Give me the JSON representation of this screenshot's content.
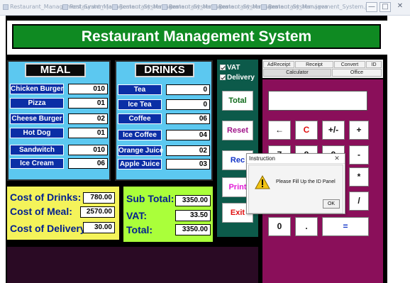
{
  "window": {
    "tabs": [
      "Restaurant_Management_System.java",
      "Restaurant_Management_System.java",
      "Restaurant_Management_System.java",
      "Restaurant_Management_System.java",
      "Restaurant_Management_System.java",
      "Restaurant_Management_System.java"
    ],
    "minimize": "—",
    "maximize": "□",
    "close": "✕"
  },
  "title": "Restaurant Management System",
  "meal": {
    "header": "MEAL",
    "items": [
      {
        "label": "Chicken Burger",
        "value": "010"
      },
      {
        "label": "Pizza",
        "value": "01"
      },
      {
        "label": "Cheese Burger",
        "value": "02"
      },
      {
        "label": "Hot Dog",
        "value": "01"
      },
      {
        "label": "Sandwitch",
        "value": "010"
      },
      {
        "label": "Ice Cream",
        "value": "06"
      }
    ]
  },
  "drinks": {
    "header": "DRINKS",
    "items": [
      {
        "label": "Tea",
        "value": "0"
      },
      {
        "label": "Ice Tea",
        "value": "0"
      },
      {
        "label": "Coffee",
        "value": "06"
      },
      {
        "label": "Ice Coffee",
        "value": "04"
      },
      {
        "label": "Orange Juice",
        "value": "02"
      },
      {
        "label": "Apple Juice",
        "value": "03"
      }
    ]
  },
  "costs": {
    "drinks_label": "Cost of Drinks:",
    "drinks_value": "780.00",
    "meal_label": "Cost of Meal:",
    "meal_value": "2570.00",
    "delivery_label": "Cost of Delivery:",
    "delivery_value": "30.00"
  },
  "totals": {
    "subtotal_label": "Sub Total:",
    "subtotal_value": "3350.00",
    "vat_label": "VAT:",
    "vat_value": "33.50",
    "total_label": "Total:",
    "total_value": "3350.00"
  },
  "options": {
    "vat_label": "VAT",
    "delivery_label": "Delivery"
  },
  "actions": {
    "total": "Total",
    "reset": "Reset",
    "receipt": "Rec",
    "print": "Print",
    "exit": "Exit"
  },
  "tabs_row1": [
    "AdReceipt",
    "Receipt",
    "Convert",
    "ID"
  ],
  "tabs_row2": [
    "Calculator",
    "Office"
  ],
  "calculator": {
    "display": "",
    "keys": [
      "←",
      "C",
      "+/-",
      "+",
      "7",
      "8",
      "9",
      "-",
      "*",
      "/",
      "0",
      ".",
      "="
    ]
  },
  "dialog": {
    "title": "Instruction",
    "message": "Please Fill Up the ID Panel",
    "ok": "OK"
  },
  "colors": {
    "title_bg": "#0f8a22",
    "label_bg": "#0b2fa6",
    "panel_cyan": "#5cc8f0",
    "panel_yellow": "#f4f35a",
    "panel_green": "#aaff3a",
    "action_panel": "#0c5a4a",
    "calculator_bg": "#8a0f5a",
    "bottom_strip": "#2a0a24"
  }
}
